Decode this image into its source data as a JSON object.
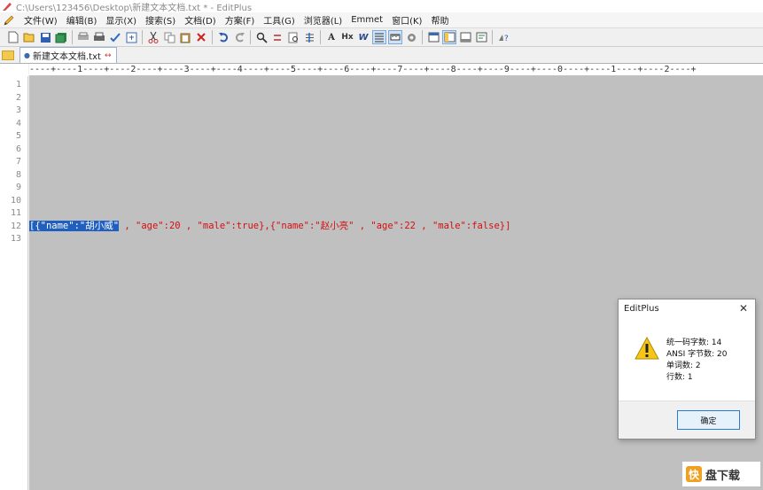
{
  "window": {
    "title": "C:\\Users\\123456\\Desktop\\新建文本文档.txt * - EditPlus"
  },
  "menu": [
    "文件(W)",
    "编辑(B)",
    "显示(X)",
    "搜索(S)",
    "文档(D)",
    "方案(F)",
    "工具(G)",
    "浏览器(L)",
    "Emmet",
    "窗口(K)",
    "帮助"
  ],
  "toolbar": {
    "icons": [
      "new-file-icon",
      "open-file-icon",
      "save-icon",
      "save-all-icon",
      "print-preview-icon",
      "print-icon",
      "spellcheck-icon",
      "browser-icon",
      "cut-icon",
      "copy-icon",
      "paste-icon",
      "delete-icon",
      "undo-icon",
      "redo-icon",
      "find-icon",
      "replace-icon",
      "find-in-files-icon",
      "goto-line-icon",
      "font-icon",
      "hex-icon",
      "word-wrap-icon",
      "line-number-icon",
      "ruler-icon",
      "settings-icon",
      "window-icon-1",
      "window-icon-2",
      "window-icon-3",
      "window-icon-4",
      "help-icon"
    ],
    "font_label": "A",
    "hex_label": "Hx",
    "wrap_label": "W"
  },
  "tab": {
    "name": "新建文本文档.txt"
  },
  "ruler": {
    "text": "----+----1----+----2----+----3----+----4----+----5----+----6----+----7----+----8----+----9----+----0----+----1----+----2----+"
  },
  "line_numbers": [
    "1",
    "2",
    "3",
    "4",
    "5",
    "6",
    "7",
    "8",
    "9",
    "10",
    "11",
    "12",
    "13"
  ],
  "editor": {
    "selected": "[{\"name\":\"胡小威\"",
    "rest": " , \"age\":20 , \"male\":true},{\"name\":\"赵小亮\" , \"age\":22 , \"male\":false}]"
  },
  "dialog": {
    "title": "EditPlus",
    "stats": [
      "统一码字数: 14",
      "ANSI 字节数: 20",
      "单词数: 2",
      "行数: 1"
    ],
    "ok_label": "确定"
  },
  "watermark": {
    "logo": "快",
    "text": "盘下载"
  },
  "colors": {
    "editor_bg": "#c0c0c0",
    "code_text": "#d01010",
    "selection": "#1f5fc0"
  }
}
